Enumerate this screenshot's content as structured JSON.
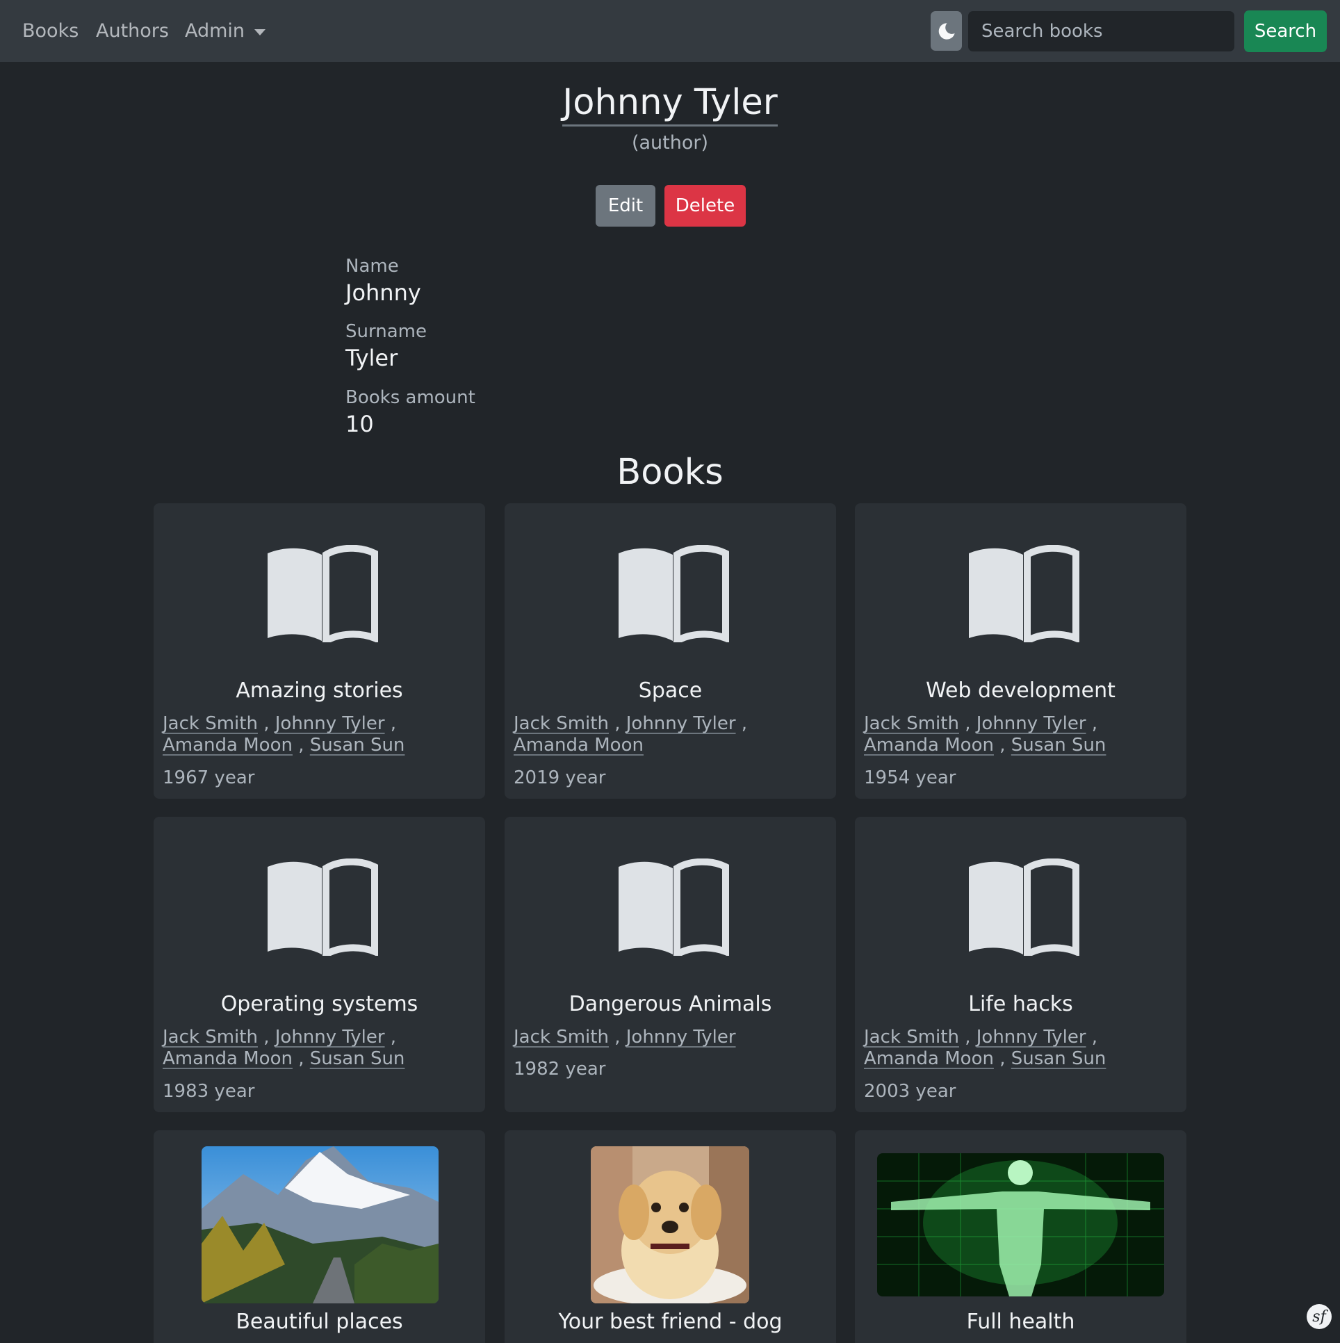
{
  "nav": {
    "books": "Books",
    "authors": "Authors",
    "admin": "Admin",
    "search_placeholder": "Search books",
    "search_button": "Search"
  },
  "author": {
    "full_name": "Johnny Tyler",
    "role": "(author)",
    "edit": "Edit",
    "delete": "Delete",
    "name_label": "Name",
    "name": "Johnny",
    "surname_label": "Surname",
    "surname": "Tyler",
    "books_amount_label": "Books amount",
    "books_amount": "10"
  },
  "books_heading": "Books",
  "books": [
    {
      "title": "Amazing stories",
      "authors": [
        "Jack Smith",
        "Johnny Tyler",
        "Amanda Moon",
        "Susan Sun"
      ],
      "year": "1967 year"
    },
    {
      "title": "Space",
      "authors": [
        "Jack Smith",
        "Johnny Tyler",
        "Amanda Moon"
      ],
      "year": "2019 year"
    },
    {
      "title": "Web development",
      "authors": [
        "Jack Smith",
        "Johnny Tyler",
        "Amanda Moon",
        "Susan Sun"
      ],
      "year": "1954 year"
    },
    {
      "title": "Operating systems",
      "authors": [
        "Jack Smith",
        "Johnny Tyler",
        "Amanda Moon",
        "Susan Sun"
      ],
      "year": "1983 year"
    },
    {
      "title": "Dangerous Animals",
      "authors": [
        "Jack Smith",
        "Johnny Tyler"
      ],
      "year": "1982 year"
    },
    {
      "title": "Life hacks",
      "authors": [
        "Jack Smith",
        "Johnny Tyler",
        "Amanda Moon",
        "Susan Sun"
      ],
      "year": "2003 year"
    },
    {
      "title": "Beautiful places"
    },
    {
      "title": "Your best friend - dog"
    },
    {
      "title": "Full health"
    }
  ],
  "colors": {
    "background": "#212529",
    "navbar": "#343a40",
    "card": "#2b3035",
    "search_button": "#198754",
    "delete_button": "#dc3545",
    "edit_button": "#6c757d"
  },
  "icons": {
    "theme": "moon-icon",
    "book": "book-open-icon",
    "framework": "symfony-icon"
  }
}
